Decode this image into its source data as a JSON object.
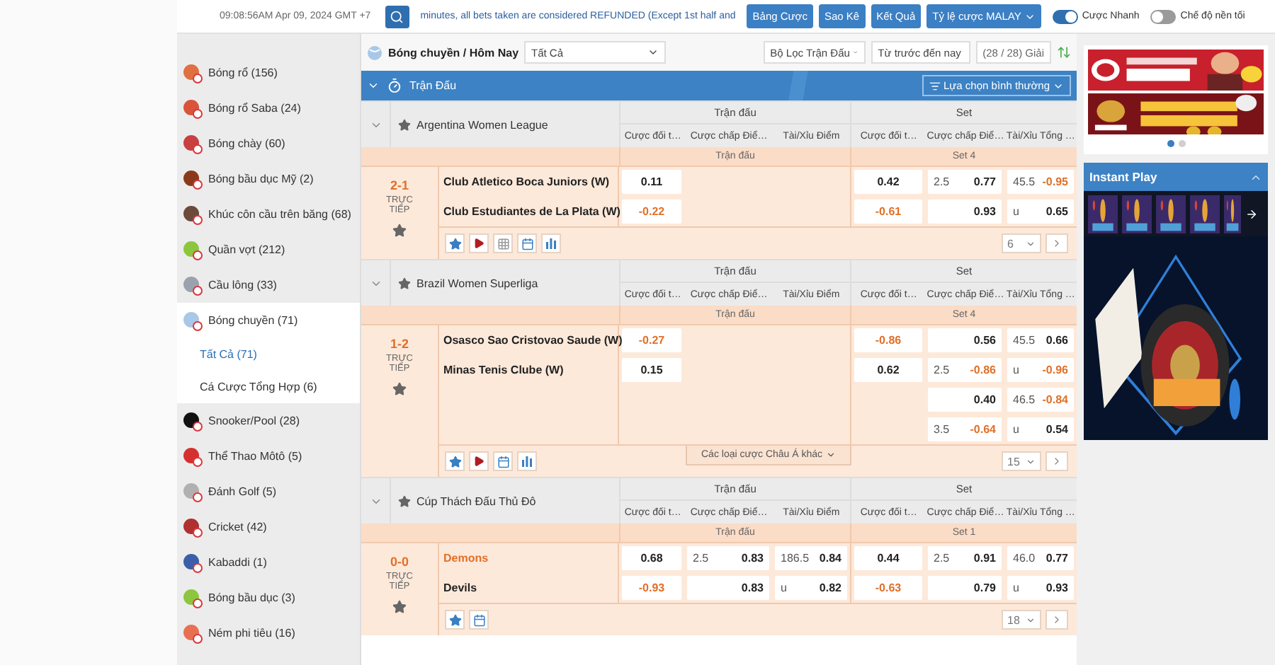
{
  "top_bar": {
    "time": "09:08:56AM Apr 09, 2024 GMT +7",
    "marquee": "minutes, all bets taken are considered REFUNDED (Except 1st half and",
    "buttons": [
      "Bảng Cược",
      "Sao Kê",
      "Kết Quả"
    ],
    "odds_type": "Tỷ lệ cược MALAY",
    "toggles": [
      {
        "label": "Cược Nhanh",
        "on": true
      },
      {
        "label": "Chế độ nền tối",
        "on": false
      }
    ]
  },
  "sidebar": {
    "items": [
      {
        "label": "Bóng rổ (156)",
        "color": "#e07040",
        "selected": false
      },
      {
        "label": "Bóng rổ Saba (24)",
        "color": "#d9543a",
        "selected": false
      },
      {
        "label": "Bóng chày (60)",
        "color": "#c84040",
        "selected": false
      },
      {
        "label": "Bóng bầu dục Mỹ (2)",
        "color": "#8a3a1a",
        "selected": false
      },
      {
        "label": "Khúc côn cầu trên băng (68)",
        "color": "#6b4a3a",
        "selected": false
      },
      {
        "label": "Quần vợt (212)",
        "color": "#8cc63f",
        "selected": false
      },
      {
        "label": "Cầu lông (33)",
        "color": "#9aa3ad",
        "selected": false
      },
      {
        "label": "Bóng chuyền (71)",
        "color": "#a9c8e8",
        "selected": true,
        "children": [
          {
            "label": "Tất Cả (71)",
            "selected": true
          },
          {
            "label": "Cá Cược Tổng Hợp (6)",
            "selected": false
          }
        ]
      },
      {
        "label": "Snooker/Pool (28)",
        "color": "#111111",
        "selected": false
      },
      {
        "label": "Thể Thao Môtô (5)",
        "color": "#d43030",
        "selected": false
      },
      {
        "label": "Đánh Golf (5)",
        "color": "#b0b0b0",
        "selected": false
      },
      {
        "label": "Cricket (42)",
        "color": "#b03030",
        "selected": false
      },
      {
        "label": "Kabaddi (1)",
        "color": "#3a5fa8",
        "selected": false
      },
      {
        "label": "Bóng bầu dục (3)",
        "color": "#8cc63f",
        "selected": false
      },
      {
        "label": "Ném phi tiêu (16)",
        "color": "#e87050",
        "selected": false
      }
    ]
  },
  "header": {
    "breadcrumb": "Bóng chuyền / Hôm Nay",
    "filter_value": "Tất Cả",
    "filters": [
      "Bộ Lọc Trận Đấu",
      "Từ trước đến nay"
    ],
    "league_count": "(28 / 28) Giải"
  },
  "section_bar": {
    "title": "Trận Đấu",
    "view_option": "Lựa chọn bình thường"
  },
  "leagues": [
    {
      "name": "Argentina Women League",
      "groups": [
        "Trận đấu",
        "Set"
      ],
      "columns": [
        "Cược đối t…",
        "Cược chấp Điể…",
        "Tài/Xỉu Điểm",
        "Cược đối t…",
        "Cược chấp Điể…",
        "Tài/Xỉu Tổng …"
      ],
      "periods": [
        "Trận đấu",
        "Set 4"
      ],
      "match": {
        "score": "2-1",
        "status": "TRỰC TIẾP",
        "teams": [
          {
            "name": "Club Atletico Boca Juniors (W)",
            "favorite": false
          },
          {
            "name": "Club Estudiantes de La Plata (W)",
            "favorite": false
          }
        ],
        "rows": [
          [
            {
              "odds": "0.11",
              "negative": false
            },
            null,
            null,
            {
              "odds": "0.42",
              "negative": false
            },
            {
              "line": "2.5",
              "odds": "0.77",
              "negative": false
            },
            {
              "line": "45.5",
              "odds": "-0.95",
              "negative": true
            }
          ],
          [
            {
              "odds": "-0.22",
              "negative": true
            },
            null,
            null,
            {
              "odds": "-0.61",
              "negative": true
            },
            {
              "odds": "0.93",
              "negative": false
            },
            {
              "line": "u",
              "odds": "0.65",
              "negative": false
            }
          ]
        ],
        "tools": [
          {
            "kind": "star"
          },
          {
            "kind": "play"
          },
          {
            "kind": "grid"
          },
          {
            "kind": "calendar"
          },
          {
            "kind": "chart"
          }
        ],
        "page": "6"
      }
    },
    {
      "name": "Brazil Women Superliga",
      "groups": [
        "Trận đấu",
        "Set"
      ],
      "columns": [
        "Cược đối t…",
        "Cược chấp Điể…",
        "Tài/Xỉu Điểm",
        "Cược đối t…",
        "Cược chấp Điể…",
        "Tài/Xỉu Tổng …"
      ],
      "periods": [
        "Trận đấu",
        "Set 4"
      ],
      "match": {
        "score": "1-2",
        "status": "TRỰC TIẾP",
        "teams": [
          {
            "name": "Osasco Sao Cristovao Saude (W)",
            "favorite": false
          },
          {
            "name": "Minas Tenis Clube (W)",
            "favorite": false
          }
        ],
        "rows": [
          [
            {
              "odds": "-0.27",
              "negative": true
            },
            null,
            null,
            {
              "odds": "-0.86",
              "negative": true
            },
            {
              "odds": "0.56",
              "negative": false
            },
            {
              "line": "45.5",
              "odds": "0.66",
              "negative": false
            }
          ],
          [
            {
              "odds": "0.15",
              "negative": false
            },
            null,
            null,
            {
              "odds": "0.62",
              "negative": false
            },
            {
              "line": "2.5",
              "odds": "-0.86",
              "negative": true
            },
            {
              "line": "u",
              "odds": "-0.96",
              "negative": true
            }
          ],
          [
            null,
            null,
            null,
            null,
            {
              "odds": "0.40",
              "negative": false
            },
            {
              "line": "46.5",
              "odds": "-0.84",
              "negative": true
            }
          ],
          [
            null,
            null,
            null,
            null,
            {
              "line": "3.5",
              "odds": "-0.64",
              "negative": true
            },
            {
              "line": "u",
              "odds": "0.54",
              "negative": false
            }
          ]
        ],
        "tools": [
          {
            "kind": "star"
          },
          {
            "kind": "play"
          },
          {
            "kind": "calendar"
          },
          {
            "kind": "chart"
          }
        ],
        "more_tab": "Các loại cược Châu Á khác",
        "page": "15"
      }
    },
    {
      "name": "Cúp Thách Đấu Thủ Đô",
      "groups": [
        "Trận đấu",
        "Set"
      ],
      "columns": [
        "Cược đối t…",
        "Cược chấp Điể…",
        "Tài/Xỉu Điểm",
        "Cược đối t…",
        "Cược chấp Điể…",
        "Tài/Xỉu Tổng …"
      ],
      "periods": [
        "Trận đấu",
        "Set 1"
      ],
      "match": {
        "score": "0-0",
        "status": "TRỰC TIẾP",
        "teams": [
          {
            "name": "Demons",
            "favorite": true
          },
          {
            "name": "Devils",
            "favorite": false
          }
        ],
        "rows": [
          [
            {
              "odds": "0.68",
              "negative": false
            },
            {
              "line": "2.5",
              "odds": "0.83",
              "negative": false
            },
            {
              "line": "186.5",
              "odds": "0.84",
              "negative": false
            },
            {
              "odds": "0.44",
              "negative": false
            },
            {
              "line": "2.5",
              "odds": "0.91",
              "negative": false
            },
            {
              "line": "46.0",
              "odds": "0.77",
              "negative": false
            }
          ],
          [
            {
              "odds": "-0.93",
              "negative": true
            },
            {
              "odds": "0.83",
              "negative": false
            },
            {
              "line": "u",
              "odds": "0.82",
              "negative": false
            },
            {
              "odds": "-0.63",
              "negative": true
            },
            {
              "odds": "0.79",
              "negative": false
            },
            {
              "line": "u",
              "odds": "0.93",
              "negative": false
            }
          ]
        ],
        "tools": [
          {
            "kind": "star"
          },
          {
            "kind": "calendar"
          }
        ],
        "page": "18"
      }
    }
  ],
  "instant_play": {
    "title": "Instant Play"
  },
  "ads": {
    "dots": [
      {
        "selected": true
      },
      {
        "selected": false
      }
    ]
  }
}
